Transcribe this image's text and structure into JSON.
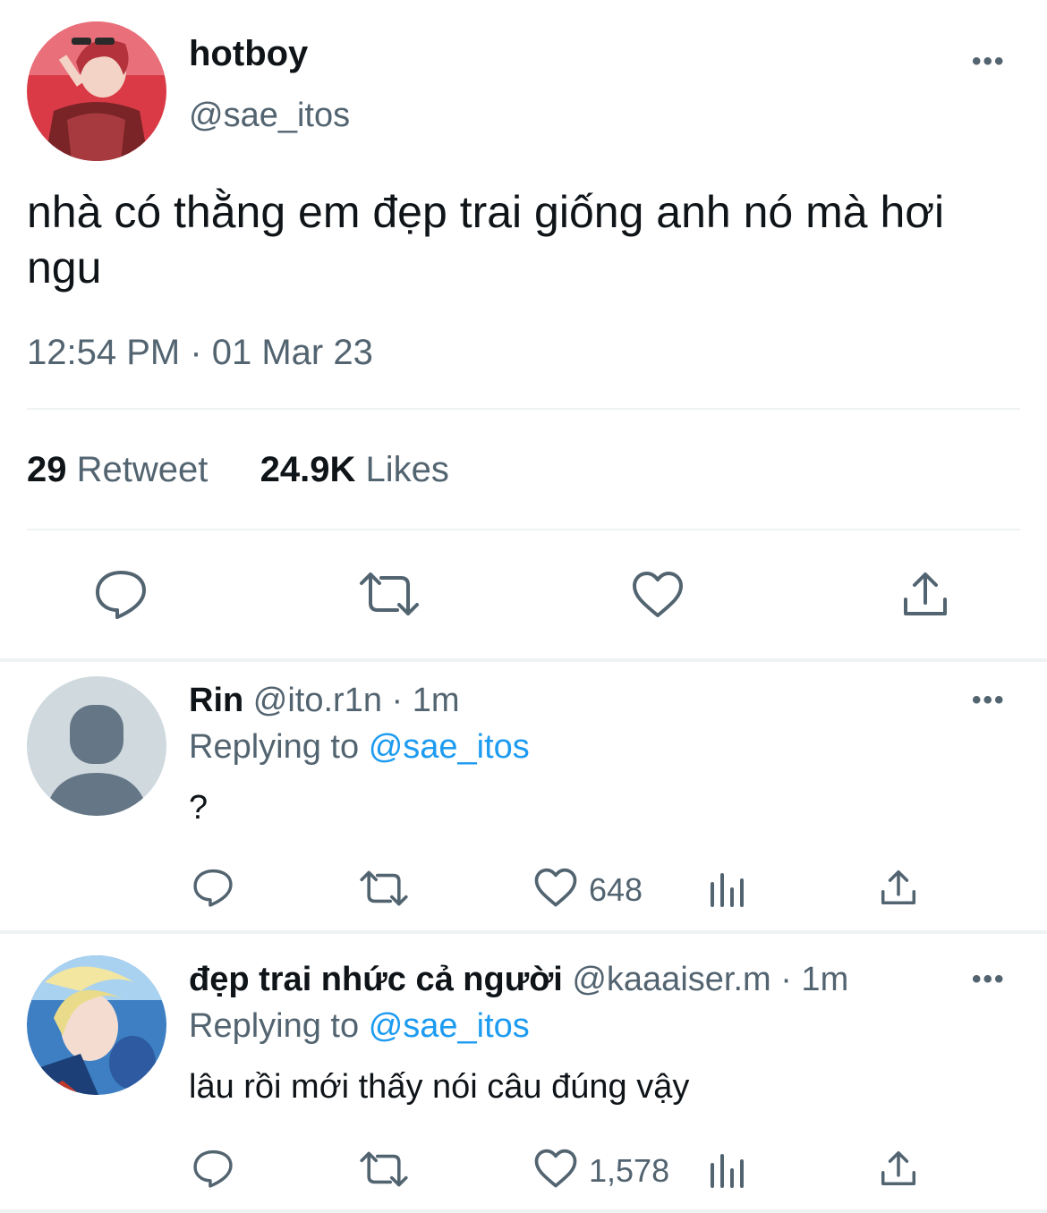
{
  "tweet": {
    "display_name": "hotboy",
    "handle": "@sae_itos",
    "text": "nhà có thằng em đẹp trai giống anh nó mà hơi ngu",
    "timestamp": "12:54 PM · 01 Mar 23",
    "retweet_count": "29",
    "retweet_label": "Retweet",
    "likes_count": "24.9K",
    "likes_label": "Likes",
    "more_icon": "•••"
  },
  "replies": [
    {
      "display_name": "Rin",
      "meta": "@ito.r1n · 1m",
      "replying_label": "Replying to",
      "replying_handle": "@sae_itos",
      "text": "?",
      "likes": "648",
      "more_icon": "•••"
    },
    {
      "display_name": "đẹp trai nhức cả người",
      "meta": "@kaaaiser.m · 1m",
      "replying_label": "Replying to",
      "replying_handle": "@sae_itos",
      "text": "lâu rồi mới thấy nói câu đúng vậy",
      "likes": "1,578",
      "more_icon": "•••"
    }
  ],
  "colors": {
    "text_primary": "#0f1419",
    "text_secondary": "#536471",
    "link": "#1d9bf0",
    "divider": "#eff3f4"
  },
  "icons": [
    "reply-icon",
    "retweet-icon",
    "like-icon",
    "share-icon",
    "analytics-icon",
    "more-icon"
  ]
}
